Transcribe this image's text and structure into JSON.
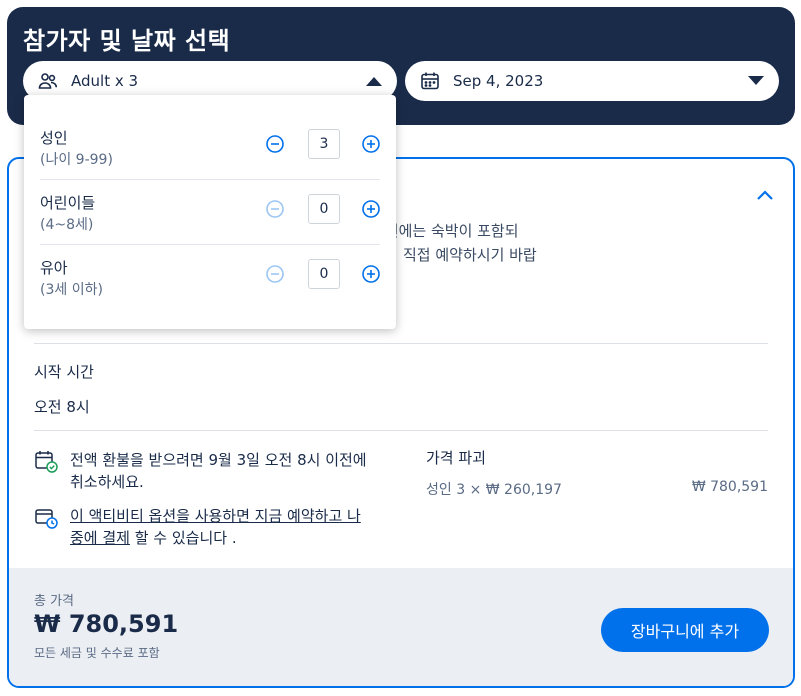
{
  "header": {
    "title": "참가자 및 날짜 선택",
    "participants_label": "Adult x 3",
    "date_label": "Sep 4, 2023"
  },
  "dropdown": {
    "rows": [
      {
        "name": "성인",
        "sub": "(나이 9-99)",
        "value": "3",
        "minus_enabled": true
      },
      {
        "name": "어린이들",
        "sub": "(4~8세)",
        "value": "0",
        "minus_enabled": false
      },
      {
        "name": "유아",
        "sub": "(3세 이하)",
        "value": "0",
        "minus_enabled": false
      }
    ]
  },
  "option": {
    "partial_line1": "옵션에는 숙박이 포함되",
    "partial_line2": "직접 예약하시기 바랍",
    "start_time_label": "시작 시간",
    "start_time_value": "오전 8시",
    "refund_text": "전액 환불을 받으려면 9월 3일 오전 8시 이전에 취소하세요.",
    "pay_later_link": "이 액티비티 옵션을 사용하면 지금 예약하고 나중에 결제",
    "pay_later_suffix": " 할 수 있습니다 .",
    "price_breakdown_title": "가격 파괴",
    "price_breakdown_line": "성인 3 × ₩ 260,197",
    "price_breakdown_amount": "₩ 780,591"
  },
  "footer": {
    "total_label": "총 가격",
    "total_value": "₩ 780,591",
    "total_note": "모든 세금 및 수수료 포함",
    "add_to_cart": "장바구니에 추가"
  },
  "colors": {
    "navy": "#1a2b49",
    "accent": "#0071eb",
    "footer_bg": "#ebeef2"
  }
}
